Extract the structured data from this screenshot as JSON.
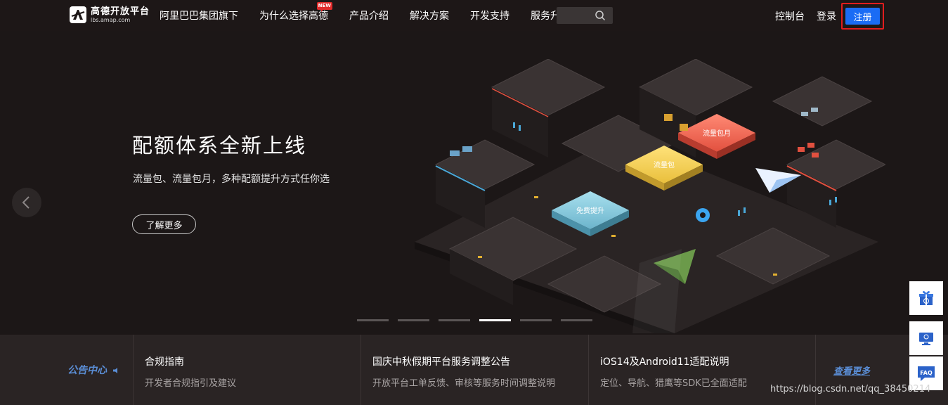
{
  "header": {
    "logo_name": "高德开放平台",
    "logo_domain": "lbs.amap.com",
    "nav": [
      {
        "label": "阿里巴巴集团旗下"
      },
      {
        "label": "为什么选择高德",
        "badge": "NEW"
      },
      {
        "label": "产品介绍"
      },
      {
        "label": "解决方案"
      },
      {
        "label": "开发支持"
      },
      {
        "label": "服务升级"
      }
    ],
    "search_placeholder": "",
    "console_label": "控制台",
    "login_label": "登录",
    "register_label": "注册"
  },
  "hero": {
    "title": "配额体系全新上线",
    "subtitle": "流量包、流量包月，多种配额提升方式任你选",
    "cta_label": "了解更多",
    "tile_labels": [
      "流量包月",
      "流量包",
      "免费提升"
    ],
    "slide_count": 6,
    "active_slide": 4
  },
  "notices": {
    "center_label": "公告中心",
    "items": [
      {
        "title": "合规指南",
        "desc": "开发者合规指引及建议"
      },
      {
        "title": "国庆中秋假期平台服务调整公告",
        "desc": "开放平台工单反馈、审核等服务时间调整说明"
      },
      {
        "title": "iOS14及Android11适配说明",
        "desc": "定位、导航、猎鹰等SDK已全面适配"
      }
    ],
    "view_more_label": "查看更多"
  },
  "float_buttons": [
    {
      "icon": "gift-icon"
    },
    {
      "icon": "monitor-icon"
    },
    {
      "icon": "faq-icon",
      "label": "FAQ"
    }
  ],
  "watermark": "https://blog.csdn.net/qq_38450214",
  "colors": {
    "accent_blue": "#1a6cf5",
    "highlight_red": "#e11d1d",
    "tile_red": "#f26b5b",
    "tile_yellow": "#f2d055",
    "tile_cyan": "#7fc4d8"
  }
}
